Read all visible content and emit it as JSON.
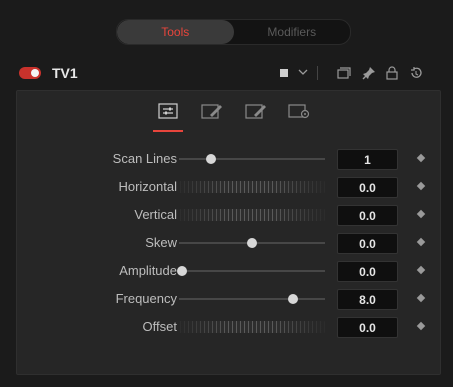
{
  "tabs": {
    "tools": "Tools",
    "modifiers": "Modifiers"
  },
  "tool": {
    "name": "TV1",
    "enabled": true
  },
  "controls": [
    {
      "label": "Scan Lines",
      "type": "slider",
      "value": "1",
      "fraction": 0.22
    },
    {
      "label": "Horizontal",
      "type": "thumbwheel",
      "value": "0.0"
    },
    {
      "label": "Vertical",
      "type": "thumbwheel",
      "value": "0.0"
    },
    {
      "label": "Skew",
      "type": "slider",
      "value": "0.0",
      "fraction": 0.5
    },
    {
      "label": "Amplitude",
      "type": "slider",
      "value": "0.0",
      "fraction": 0.02
    },
    {
      "label": "Frequency",
      "type": "slider",
      "value": "8.0",
      "fraction": 0.78
    },
    {
      "label": "Offset",
      "type": "thumbwheel",
      "value": "0.0"
    }
  ],
  "colors": {
    "accent": "#e8453c",
    "background": "#1b1b1b",
    "panel": "#262626"
  },
  "icons": [
    "color-square-icon",
    "chevron-down-icon",
    "versions-icon",
    "pin-icon",
    "lock-icon",
    "reset-icon",
    "controls-tab-icon",
    "edit-tab-icon",
    "edit-tab-2-icon",
    "settings-tab-icon",
    "keyframe-icon"
  ]
}
